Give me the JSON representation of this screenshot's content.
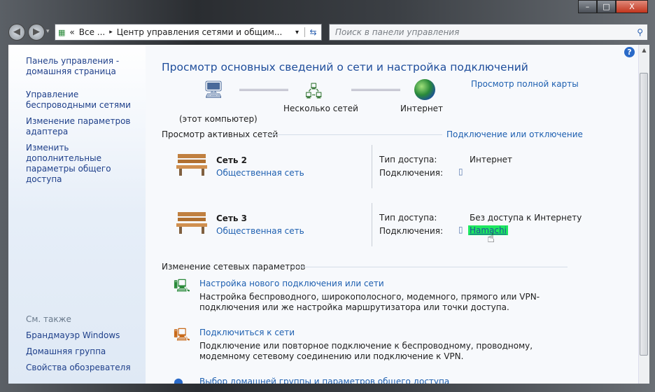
{
  "window": {
    "minimize": "–",
    "maximize": "□",
    "close": "X"
  },
  "address": {
    "breadcrumb_start": "«",
    "crumb1": "Все ...",
    "sep": "▸",
    "crumb2": "Центр управления сетями и общим...",
    "dropdown": "▾"
  },
  "search": {
    "placeholder": "Поиск в панели управления"
  },
  "sidebar": {
    "items": [
      {
        "label": "Панель управления - домашняя страница"
      },
      {
        "label": "Управление беспроводными сетями"
      },
      {
        "label": "Изменение параметров адаптера"
      },
      {
        "label": "Изменить дополнительные параметры общего доступа"
      }
    ],
    "see_also": "См. также",
    "see_also_items": [
      {
        "label": "Брандмауэр Windows"
      },
      {
        "label": "Домашняя группа"
      },
      {
        "label": "Свойства обозревателя"
      }
    ]
  },
  "main": {
    "title": "Просмотр основных сведений о сети и настройка подключений",
    "full_map": "Просмотр полной карты",
    "map": {
      "computer": "(этот компьютер)",
      "networks": "Несколько сетей",
      "internet": "Интернет"
    },
    "active_header": "Просмотр активных сетей",
    "connect_link": "Подключение или отключение",
    "networks": [
      {
        "name": "Сеть  2",
        "type": "Общественная сеть",
        "access_label": "Тип доступа:",
        "access": "Интернет",
        "conn_label": "Подключения:",
        "conn": ""
      },
      {
        "name": "Сеть  3",
        "type": "Общественная сеть",
        "access_label": "Тип доступа:",
        "access": "Без доступа к Интернету",
        "conn_label": "Подключения:",
        "conn": "Hamachi"
      }
    ],
    "change_header": "Изменение сетевых параметров",
    "tasks": [
      {
        "title": "Настройка нового подключения или сети",
        "desc": "Настройка беспроводного, широкополосного, модемного, прямого или VPN-подключения или же настройка маршрутизатора или точки доступа."
      },
      {
        "title": "Подключиться к сети",
        "desc": "Подключение или повторное подключение к беспроводному, проводному, модемному сетевому соединению или подключение к VPN."
      },
      {
        "title": "Выбор домашней группы и параметров общего доступа",
        "desc": ""
      }
    ]
  }
}
